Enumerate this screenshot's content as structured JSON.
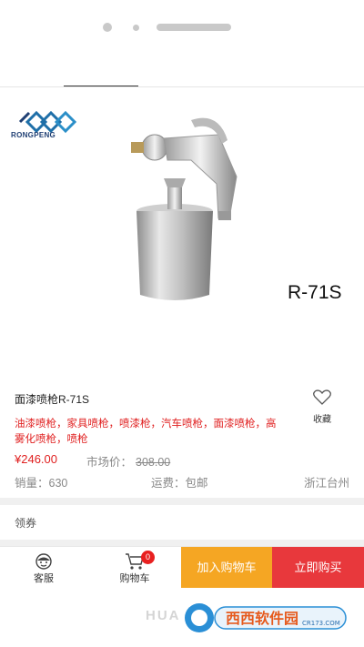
{
  "product": {
    "brand": "RONGPENG",
    "model_tag": "R-71S",
    "title": "面漆喷枪R-71S",
    "tags": "油漆喷枪，家具喷枪，喷漆枪，汽车喷枪，面漆喷枪，高雾化喷枪，喷枪",
    "price": "¥246.00",
    "market_label": "市场价：",
    "market_price": "308.00",
    "sales_label": "销量：",
    "sales": "630",
    "freight_label": "运费：",
    "freight": "包邮",
    "origin": "浙江台州"
  },
  "favorite": {
    "label": "收藏",
    "icon": "heart-icon"
  },
  "coupon": {
    "label": "领券"
  },
  "bottom_bar": {
    "service_label": "客服",
    "service_icon": "customer-service-icon",
    "cart_label": "购物车",
    "cart_icon": "shopping-cart-icon",
    "cart_count": "0",
    "add_to_cart": "加入购物车",
    "buy_now": "立即购买"
  },
  "footer": {
    "home_text": "HUA",
    "watermark": "西西软件园",
    "watermark_sub": "CR173.COM"
  },
  "colors": {
    "accent_red": "#e02020",
    "cart_orange": "#f5a623",
    "buy_red": "#e8383c"
  }
}
